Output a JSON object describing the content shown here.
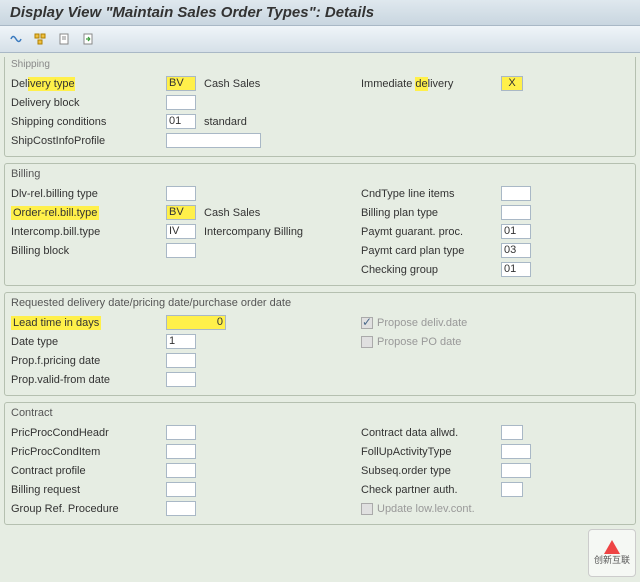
{
  "title": "Display View \"Maintain Sales Order Types\": Details",
  "toolbar_icons": [
    "toggle-icon",
    "tree-icon",
    "page-icon",
    "nav-icon"
  ],
  "groups": {
    "shipping": {
      "title": "Shipping",
      "delivery_type": {
        "label": "Delivery type",
        "value": "BV",
        "desc": "Cash Sales"
      },
      "immediate_delivery": {
        "label": "Immediate delivery",
        "value": "X"
      },
      "delivery_block": {
        "label": "Delivery block",
        "value": ""
      },
      "shipping_conditions": {
        "label": "Shipping conditions",
        "value": "01",
        "desc": "standard"
      },
      "ship_cost_info": {
        "label": "ShipCostInfoProfile",
        "value": ""
      }
    },
    "billing": {
      "title": "Billing",
      "dlv_rel": {
        "label": "Dlv-rel.billing type",
        "value": ""
      },
      "cnd_type": {
        "label": "CndType line items",
        "value": ""
      },
      "order_rel": {
        "label": "Order-rel.bill.type",
        "value": "BV",
        "desc": "Cash Sales"
      },
      "bill_plan": {
        "label": "Billing plan type",
        "value": ""
      },
      "intercomp": {
        "label": "Intercomp.bill.type",
        "value": "IV",
        "desc": "Intercompany Billing"
      },
      "paymt_guar": {
        "label": "Paymt guarant. proc.",
        "value": "01"
      },
      "bill_block": {
        "label": "Billing block",
        "value": ""
      },
      "paymt_card": {
        "label": "Paymt card plan type",
        "value": "03"
      },
      "check_grp": {
        "label": "Checking group",
        "value": "01"
      }
    },
    "requested": {
      "title": "Requested delivery date/pricing date/purchase order date",
      "lead_time": {
        "label": "Lead time in days",
        "value": "0"
      },
      "propose_deliv": {
        "label": "Propose deliv.date",
        "checked": true
      },
      "date_type": {
        "label": "Date type",
        "value": "1"
      },
      "propose_po": {
        "label": "Propose PO date",
        "checked": false
      },
      "prop_pricing": {
        "label": "Prop.f.pricing date",
        "value": ""
      },
      "prop_valid": {
        "label": "Prop.valid-from date",
        "value": ""
      }
    },
    "contract": {
      "title": "Contract",
      "pric_headr": {
        "label": "PricProcCondHeadr",
        "value": ""
      },
      "contract_data": {
        "label": "Contract data allwd.",
        "value": ""
      },
      "pric_item": {
        "label": "PricProcCondItem",
        "value": ""
      },
      "follup": {
        "label": "FollUpActivityType",
        "value": ""
      },
      "contract_profile": {
        "label": "Contract profile",
        "value": ""
      },
      "subseq": {
        "label": "Subseq.order type",
        "value": ""
      },
      "bill_req": {
        "label": "Billing request",
        "value": ""
      },
      "check_partner": {
        "label": "Check partner auth.",
        "value": ""
      },
      "group_ref": {
        "label": "Group Ref. Procedure",
        "value": ""
      },
      "update_low": {
        "label": "Update low.lev.cont.",
        "checked": false
      }
    }
  },
  "watermark": "创新互联"
}
